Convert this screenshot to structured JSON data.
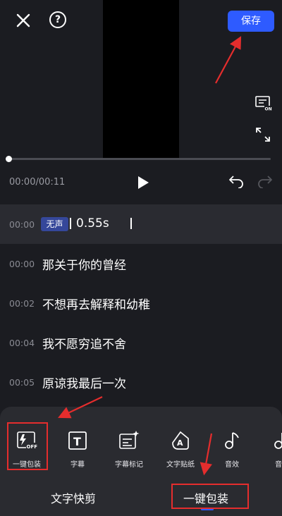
{
  "toolbar": {
    "help_glyph": "?",
    "save_label": "保存"
  },
  "player": {
    "time": "00:00/00:11"
  },
  "subtitles": {
    "rows": [
      {
        "time": "00:00",
        "badge": "无声",
        "text": "0.55s"
      },
      {
        "time": "00:00",
        "text": "那关于你的曾经"
      },
      {
        "time": "00:02",
        "text": "不想再去解释和幼稚"
      },
      {
        "time": "00:04",
        "text": "我不愿穷追不舍"
      },
      {
        "time": "00:05",
        "text": "原谅我最后一次"
      }
    ]
  },
  "tools": [
    {
      "label": "一键包装",
      "icon": "one-click-package-icon",
      "badge": "OFF"
    },
    {
      "label": "字幕",
      "icon": "subtitle-icon",
      "glyph": "T"
    },
    {
      "label": "字幕标记",
      "icon": "subtitle-mark-icon"
    },
    {
      "label": "文字贴纸",
      "icon": "text-sticker-icon",
      "glyph": "A"
    },
    {
      "label": "音效",
      "icon": "sound-effect-icon",
      "glyph": "♪"
    },
    {
      "label": "音",
      "icon": "music-icon",
      "glyph": "♪"
    }
  ],
  "bottom_nav": {
    "tab_left": "文字快剪",
    "tab_right": "一键包装"
  },
  "colors": {
    "accent": "#2e5bff",
    "annotation": "#e52d2d",
    "background": "#1b1c21"
  }
}
